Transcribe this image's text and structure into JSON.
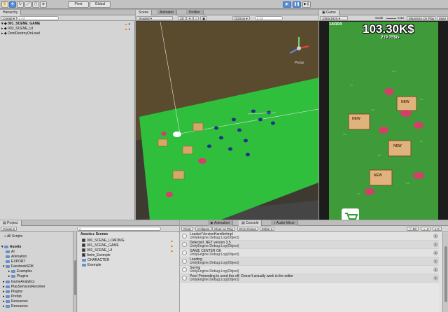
{
  "toolbar": {
    "pivot_label": "Pivot",
    "global_label": "Global"
  },
  "hierarchy": {
    "tab": "Hierarchy",
    "create_label": "Create",
    "search_placeholder": "All",
    "items": [
      {
        "label": "001_SCENE_GAME",
        "badge": "2"
      },
      {
        "label": "002_SCENE_UI",
        "badge": "1"
      },
      {
        "label": "DontDestroyOnLoad",
        "badge": ""
      }
    ]
  },
  "scene": {
    "tabs": [
      "Scene",
      "Animator",
      "Profiler"
    ],
    "shading": "Shaded",
    "mode_2d": "2D",
    "gizmos": "Gizmos",
    "search_placeholder": "All",
    "persp_label": "Persp"
  },
  "game": {
    "tab": "Game",
    "resolution": "1080x1920",
    "scale_label": "Scale",
    "scale_value": "0.33",
    "maximize": "Maximize On Play",
    "mute": "Mute",
    "level": "14/104",
    "money": "103.30K$",
    "rate": "219.75$/s",
    "box_label": "NEW"
  },
  "project": {
    "tabs": [
      "Project",
      "Animation"
    ],
    "create_label": "Create",
    "favorites": [
      "All Scripts"
    ],
    "folders": [
      "Assets",
      "AI",
      "Animation",
      "EXPORT",
      "FacebookSDK",
      "Examples",
      "Plugins",
      "GameAnalytics",
      "PlayServicesResolver",
      "Plugins",
      "Prefab",
      "Resources",
      "Resources"
    ],
    "breadcrumb": [
      "Assets",
      "Scenes"
    ],
    "files": [
      "000_SCENE_LOADING",
      "001_SCENE_GAME",
      "002_SCENE_UI",
      "Anim_Exemple",
      "CHARACTER",
      "Exemple"
    ]
  },
  "console": {
    "tabs": [
      "Console",
      "Audio Mixer"
    ],
    "toolbar": [
      "Clear",
      "Collapse",
      "Clear on Play",
      "Error Pause",
      "Editor"
    ],
    "counts": {
      "info": "58",
      "warn": "2",
      "error": "0"
    },
    "logs": [
      {
        "line1": "Loaded VersionHandlerImpl",
        "line2": "UnityEngine.Debug:Log(Object)",
        "count": "1"
      },
      {
        "line1": "Detected .NET version 3.5",
        "line2": "UnityEngine.Debug:Log(Object)",
        "count": "1"
      },
      {
        "line1": "GAME CENTER OK",
        "line2": "UnityEngine.Debug:Log(Object)",
        "count": "1"
      },
      {
        "line1": "Loading",
        "line2": "UnityEngine.Debug:Log(Object)",
        "count": "1"
      },
      {
        "line1": "Saving",
        "line2": "UnityEngine.Debug:Log(Object)",
        "count": "1"
      },
      {
        "line1": "Pew! Pretending to send this off.  Doesn't actually work in the editor",
        "line2": "UnityEngine.Debug:Log(Object)",
        "count": "1"
      }
    ]
  },
  "colors": {
    "grass": "#3f9a3a",
    "scene_grass": "#2fbf3c",
    "dirt": "#5a4a2e",
    "accent": "#5a8fd6"
  }
}
